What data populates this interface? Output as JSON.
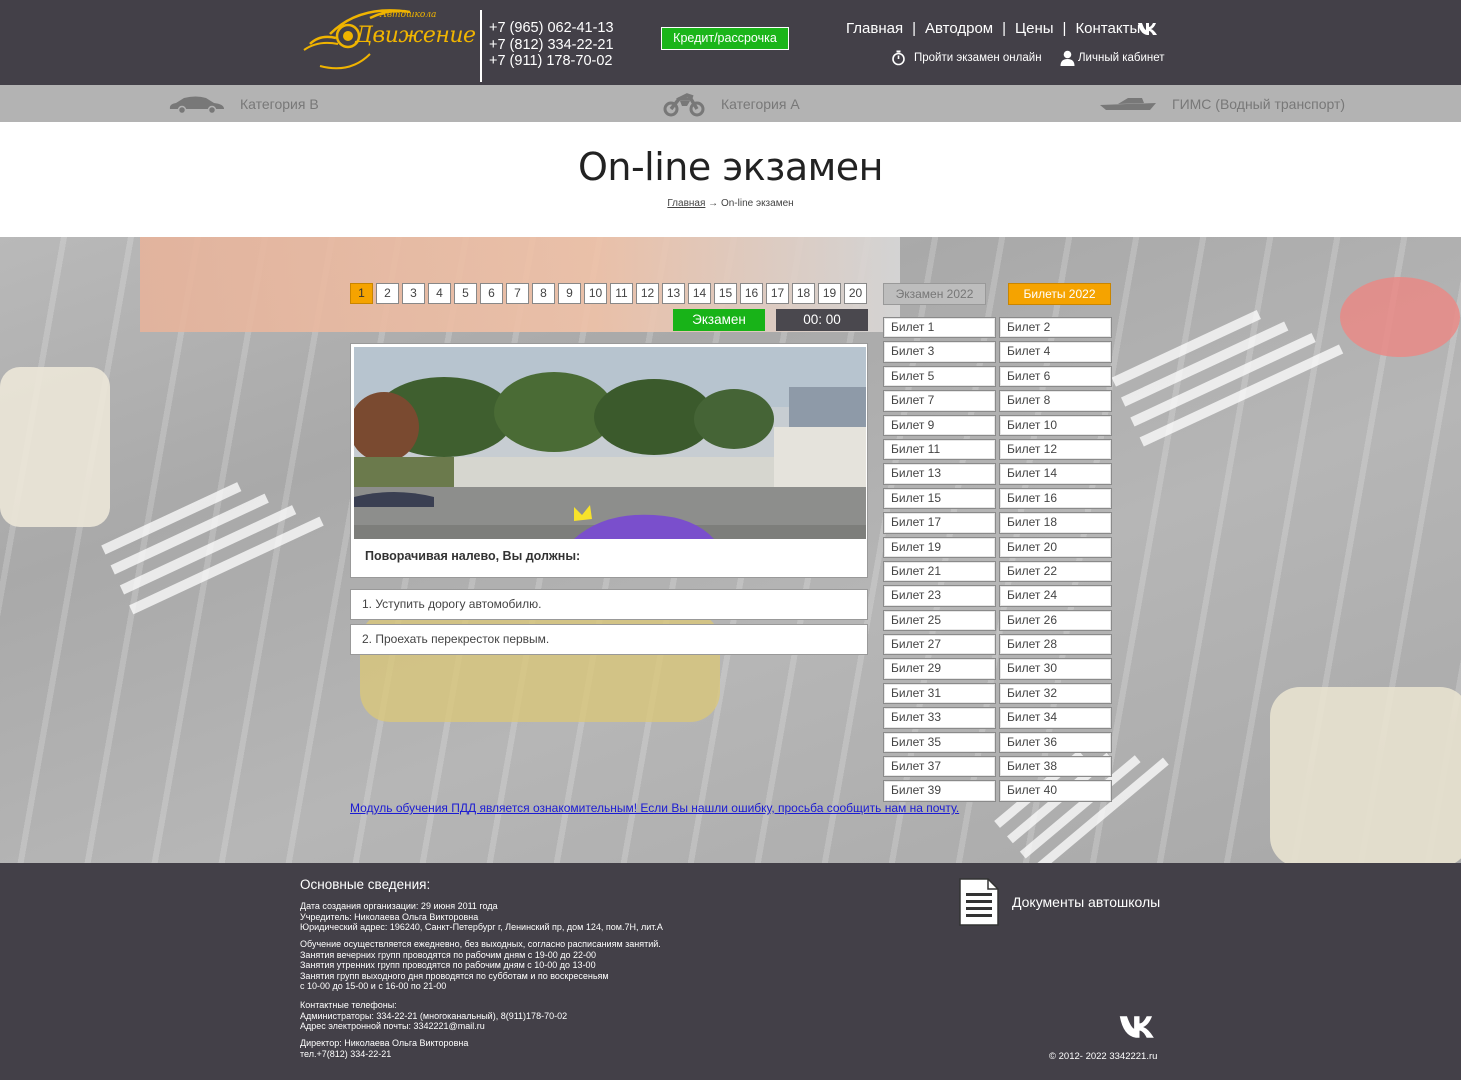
{
  "logo": {
    "script": "Движение",
    "small": "Автошкола"
  },
  "phones": [
    "+7 (965) 062-41-13",
    "+7 (812) 334-22-21",
    "+7 (911) 178-70-02"
  ],
  "credit_button": "Кредит/рассрочка",
  "topnav": [
    "Главная",
    "Автодром",
    "Цены",
    "Контакты"
  ],
  "subnav": {
    "exam_online": "Пройти экзамен онлайн",
    "cabinet": "Личный кабинет"
  },
  "categories": [
    "Категория B",
    "Категория A",
    "ГИМС (Водный транспорт)"
  ],
  "page_title": "On-line экзамен",
  "breadcrumb": {
    "home": "Главная",
    "arrow": "→",
    "current": "On-line экзамен"
  },
  "question_numbers": [
    "1",
    "2",
    "3",
    "4",
    "5",
    "6",
    "7",
    "8",
    "9",
    "10",
    "11",
    "12",
    "13",
    "14",
    "15",
    "16",
    "17",
    "18",
    "19",
    "20"
  ],
  "active_question": "1",
  "exam_label": "Экзамен",
  "timer": "00: 00",
  "question": {
    "text": "Поворачивая налево, Вы должны:",
    "answers": [
      "1. Уступить дорогу автомобилю.",
      "2. Проехать перекресток первым."
    ]
  },
  "tabs": {
    "exam": "Экзамен 2022",
    "tickets": "Билеты 2022"
  },
  "tickets": [
    "Билет 1",
    "Билет 2",
    "Билет 3",
    "Билет 4",
    "Билет 5",
    "Билет 6",
    "Билет 7",
    "Билет 8",
    "Билет 9",
    "Билет 10",
    "Билет 11",
    "Билет 12",
    "Билет 13",
    "Билет 14",
    "Билет 15",
    "Билет 16",
    "Билет 17",
    "Билет 18",
    "Билет 19",
    "Билет 20",
    "Билет 21",
    "Билет 22",
    "Билет 23",
    "Билет 24",
    "Билет 25",
    "Билет 26",
    "Билет 27",
    "Билет 28",
    "Билет 29",
    "Билет 30",
    "Билет 31",
    "Билет 32",
    "Билет 33",
    "Билет 34",
    "Билет 35",
    "Билет 36",
    "Билет 37",
    "Билет 38",
    "Билет 39",
    "Билет 40"
  ],
  "notice": "Модуль обучения ПДД является ознакомительным! Если Вы нашли ошибку, просьба сообщить нам на почту.",
  "footer": {
    "heading": "Основные сведения:",
    "info": [
      "Дата создания организации: 29 июня 2011 года",
      "Учредитель: Николаева Ольга Викторовна",
      "Юридический адрес: 196240, Санкт-Петербург г, Ленинский пр, дом 124, пом.7Н, лит.А"
    ],
    "schedule": [
      "Обучение осуществляется ежедневно, без выходных, согласно расписаниям занятий.",
      "Занятия вечерних групп проводятся по рабочим дням с 19-00 до 22-00",
      "Занятия утренних групп проводятся по рабочим дням с 10-00 до 13-00",
      "Занятия групп выходного дня проводятся по субботам и по воскресеньям",
      "с 10-00 до 15-00 и с 16-00 по 21-00"
    ],
    "contacts": [
      "Контактные телефоны:",
      "Администраторы: 334-22-21 (многоканальный), 8(911)178-70-02",
      "Адрес электронной почты: 3342221@mail.ru"
    ],
    "director": [
      "Директор: Николаева Ольга Викторовна",
      "тел.+7(812) 334-22-21"
    ],
    "docs": "Документы автошколы",
    "copyright": "© 2012- 2022 3342221.ru"
  },
  "colors": {
    "header_bg": "#434048",
    "accent_orange": "#f5a300",
    "accent_green": "#18b318",
    "logo_gold": "#f0b400"
  }
}
